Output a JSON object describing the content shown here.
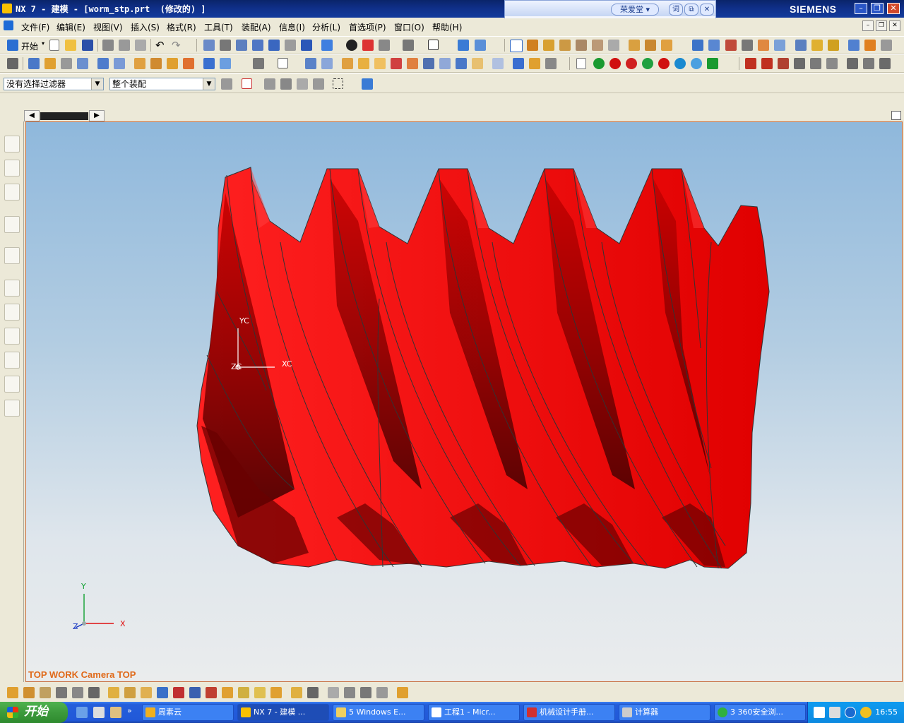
{
  "titlebar": {
    "title": "NX 7 - 建模 - [worm_stp.prt  (修改的) ]",
    "brand": "SIEMENS",
    "min": "–",
    "max": "❐",
    "close": "✕"
  },
  "floating_widget": {
    "label": "荣爱堂 ▾",
    "btn1": "词",
    "btn2": "⧉",
    "btn3": "✕"
  },
  "menu": {
    "items": [
      "文件(F)",
      "编辑(E)",
      "视图(V)",
      "插入(S)",
      "格式(R)",
      "工具(T)",
      "装配(A)",
      "信息(I)",
      "分析(L)",
      "首选项(P)",
      "窗口(O)",
      "帮助(H)"
    ]
  },
  "toolbar": {
    "start_label": "开始",
    "filter_value": "没有选择过滤器",
    "scope_value": "整个装配"
  },
  "viewport": {
    "label": "TOP WORK Camera TOP",
    "wcs": {
      "x": "XC",
      "y": "YC",
      "z": "ZC"
    },
    "abs": {
      "x": "X",
      "y": "Y",
      "z": "Z"
    },
    "model_color": "#ff0f0f"
  },
  "taskbar": {
    "start": "开始",
    "tasks": [
      {
        "label": "周素云"
      },
      {
        "label": "NX 7 - 建模 ..."
      },
      {
        "label": "5 Windows E..."
      },
      {
        "label": "工程1 - Micr..."
      },
      {
        "label": "机械设计手册..."
      },
      {
        "label": "计算器"
      },
      {
        "label": "3 360安全浏..."
      }
    ],
    "clock": "16:55"
  }
}
